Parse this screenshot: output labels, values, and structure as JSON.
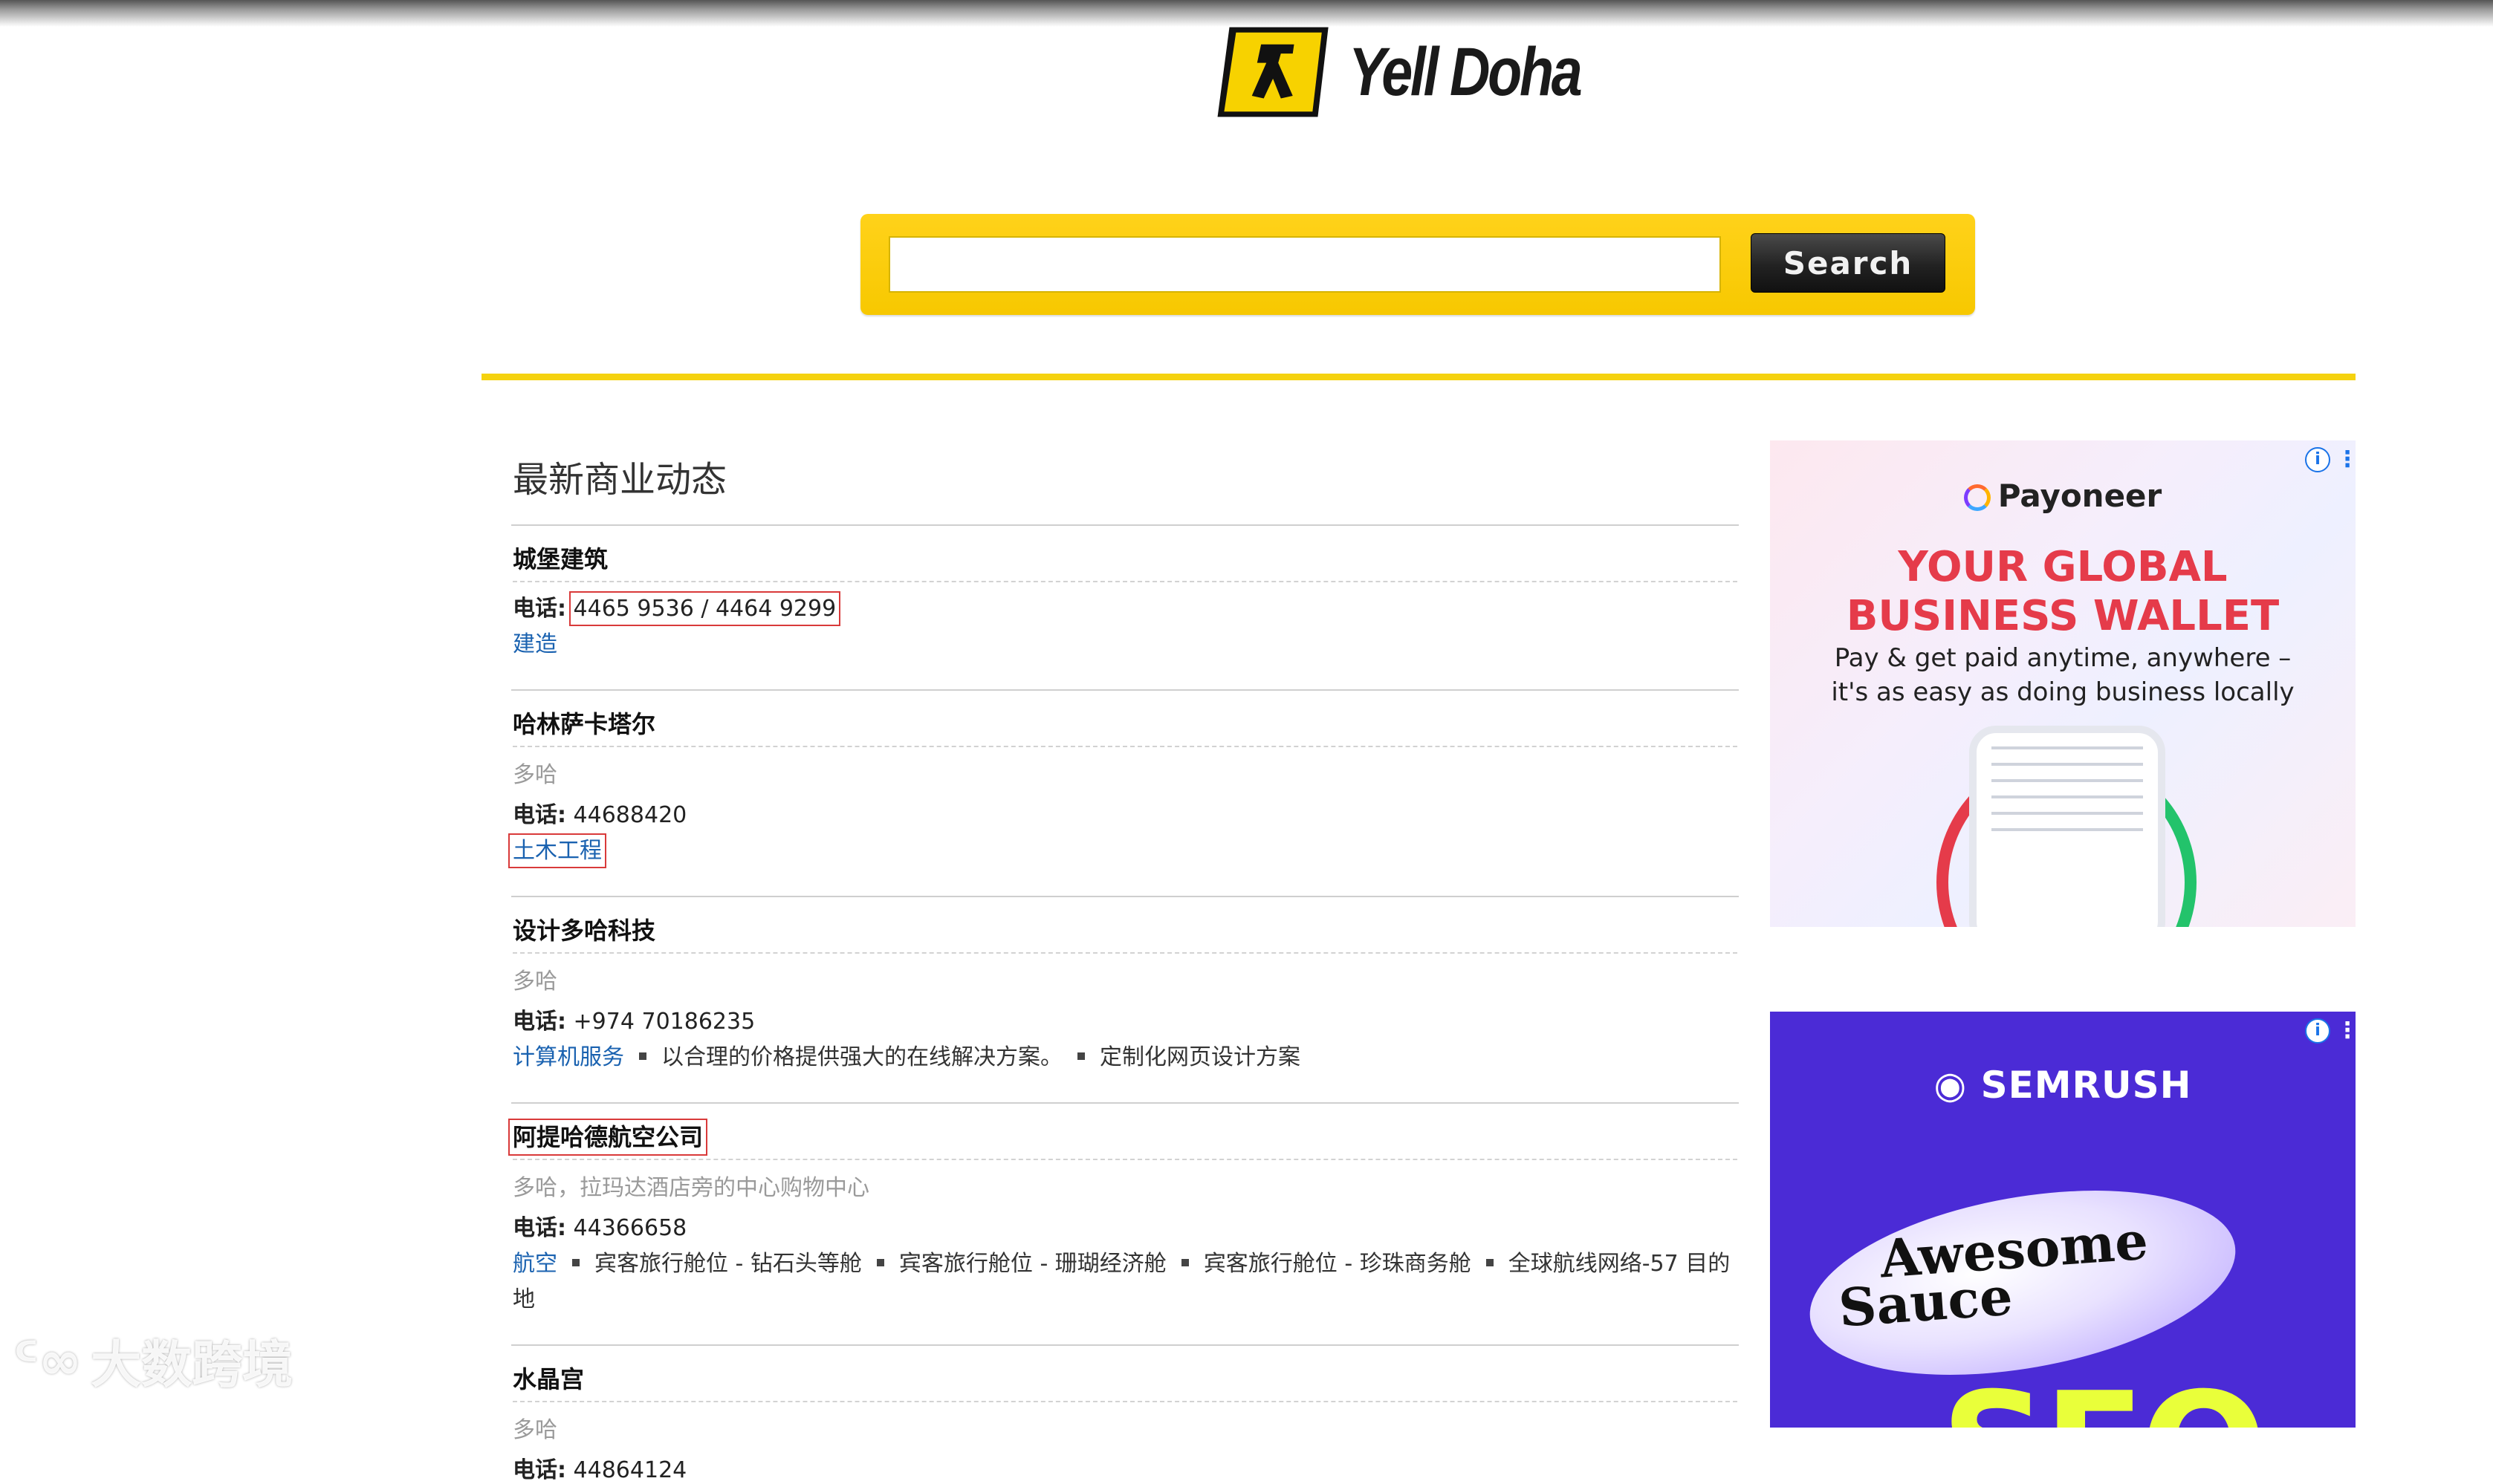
{
  "header": {
    "logo_text": "Yell Doha",
    "search": {
      "value": "",
      "placeholder": "",
      "button_label": "Search"
    },
    "colors": {
      "brand_yellow": "#f5d20f",
      "link_blue": "#1a62b0"
    }
  },
  "main": {
    "section_title": "最新商业动态",
    "phone_label": "电话:",
    "listings": [
      {
        "name": "城堡建筑",
        "location": "",
        "phone": "4465 9536 / 4464 9299",
        "category": "建造",
        "tags": []
      },
      {
        "name": "哈林萨卡塔尔",
        "location": "多哈",
        "phone": "44688420",
        "category": "土木工程",
        "tags": []
      },
      {
        "name": "设计多哈科技",
        "location": "多哈",
        "phone": "+974 70186235",
        "category": "计算机服务",
        "tags": [
          "以合理的价格提供强大的在线解决方案。",
          "定制化网页设计方案"
        ]
      },
      {
        "name": "阿提哈德航空公司",
        "location": "多哈，拉玛达酒店旁的中心购物中心",
        "phone": "44366658",
        "category": "航空",
        "tags": [
          "宾客旅行舱位 - 钻石头等舱",
          "宾客旅行舱位 - 珊瑚经济舱",
          "宾客旅行舱位 - 珍珠商务舱",
          "全球航线网络-57 目的地"
        ]
      },
      {
        "name": "水晶宫",
        "location": "多哈",
        "phone": "44864124",
        "category": "",
        "tags": []
      }
    ]
  },
  "ads": {
    "payoneer": {
      "brand": "Payoneer",
      "headline_1": "YOUR GLOBAL",
      "headline_2": "BUSINESS WALLET",
      "sub_1": "Pay & get paid anytime, anywhere –",
      "sub_2": "it's as easy as doing business locally",
      "info_icon": "info-icon",
      "more_icon": "more-vertical-icon"
    },
    "semrush": {
      "brand": "SEMRUSH",
      "line_1": "Awesome",
      "line_2": "Sauce",
      "big_text": "SEO",
      "info_icon": "info-icon",
      "more_icon": "more-vertical-icon"
    }
  },
  "watermark": {
    "text": "大数跨境"
  }
}
